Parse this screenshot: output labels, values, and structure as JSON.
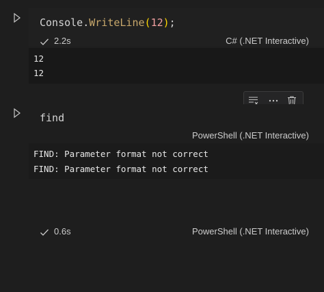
{
  "cells": [
    {
      "language_label": "C# (.NET Interactive)",
      "code_tokens": {
        "class_name": "Console",
        "dot": ".",
        "method": "WriteLine",
        "open_paren": "(",
        "arg": "12",
        "close_paren": ")",
        "semicolon": ";"
      },
      "status": {
        "time": "2.2s",
        "icon": "check-icon"
      },
      "output_lines": [
        "12",
        "12"
      ]
    },
    {
      "language_label": "PowerShell (.NET Interactive)",
      "code": "find",
      "output_lines": [
        "FIND: Parameter format not correct",
        "FIND: Parameter format not correct"
      ],
      "status": {
        "time": "0.6s",
        "icon": "check-icon",
        "language_label": "PowerShell (.NET Interactive)"
      },
      "toolbar": [
        "clear-output-icon",
        "more-actions-icon",
        "delete-icon"
      ]
    }
  ],
  "colors": {
    "background": "#1e1e1e",
    "method": "#c8a86b",
    "paren": "#ffd700",
    "number": "#f0a0a0",
    "output_bg": "#181818"
  }
}
